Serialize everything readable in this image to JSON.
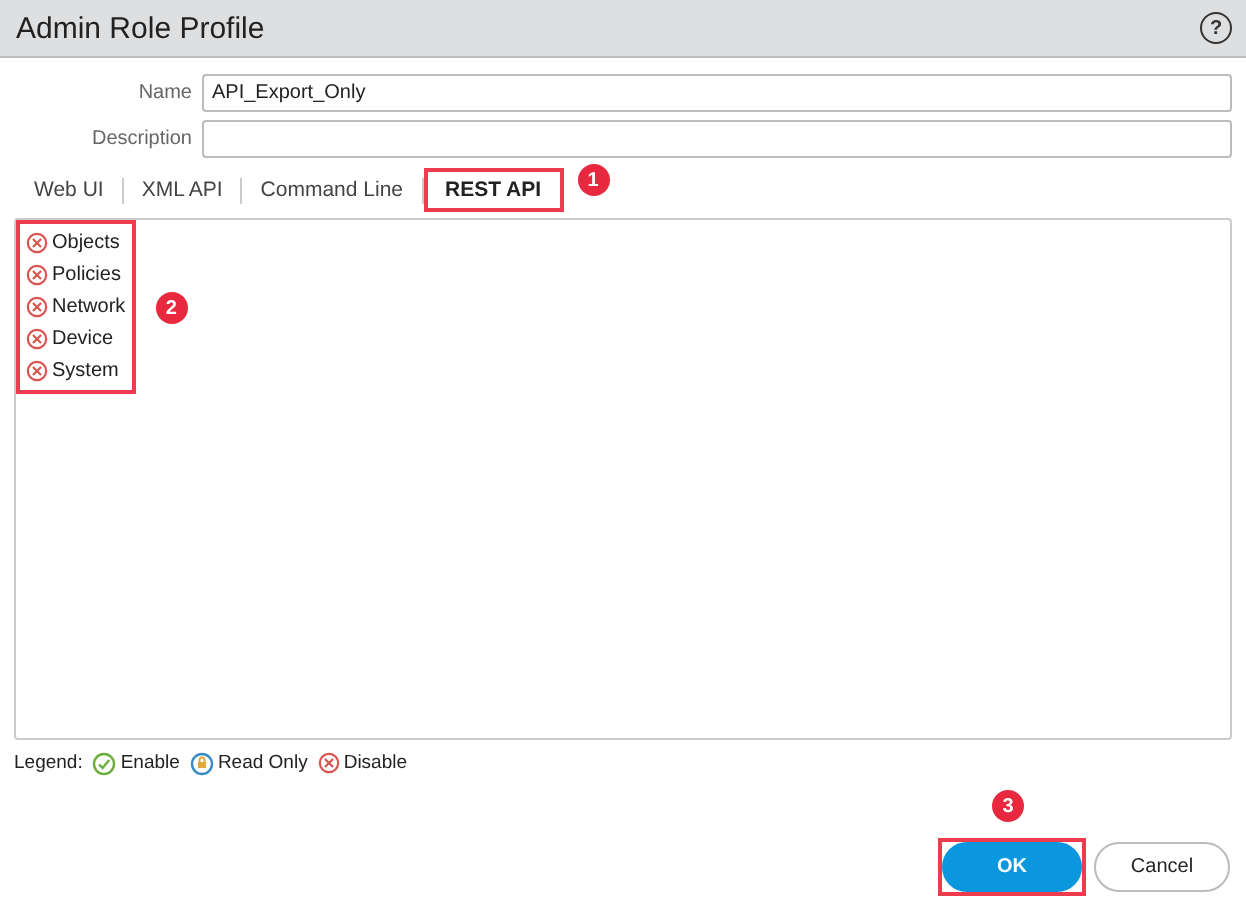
{
  "window": {
    "title": "Admin Role Profile",
    "help": "?"
  },
  "fields": [
    {
      "label": "Name",
      "value": "API_Export_Only"
    },
    {
      "label": "Description"
    }
  ],
  "tabs": [
    {
      "label": "Web UI",
      "selected": false
    },
    {
      "label": "XML API",
      "selected": false
    },
    {
      "label": "Command Line",
      "selected": false
    },
    {
      "label": "REST API",
      "selected": true,
      "callout": "1"
    }
  ],
  "permissions": {
    "callout": "2",
    "items": [
      {
        "label": "Objects",
        "kind": "disable"
      },
      {
        "label": "Policies",
        "kind": "disable"
      },
      {
        "label": "Network",
        "kind": "disable"
      },
      {
        "label": "Device",
        "kind": "disable"
      },
      {
        "label": "System",
        "kind": "disable"
      }
    ]
  },
  "legend": {
    "label": "Legend:",
    "items": [
      {
        "label": "Enable",
        "kind": "enable"
      },
      {
        "label": "Read Only",
        "kind": "readonly"
      },
      {
        "label": "Disable",
        "kind": "disable"
      }
    ]
  },
  "buttons": [
    {
      "label": "OK",
      "kind": "primary",
      "callout": "3"
    },
    {
      "label": "Cancel",
      "kind": "secondary"
    }
  ]
}
